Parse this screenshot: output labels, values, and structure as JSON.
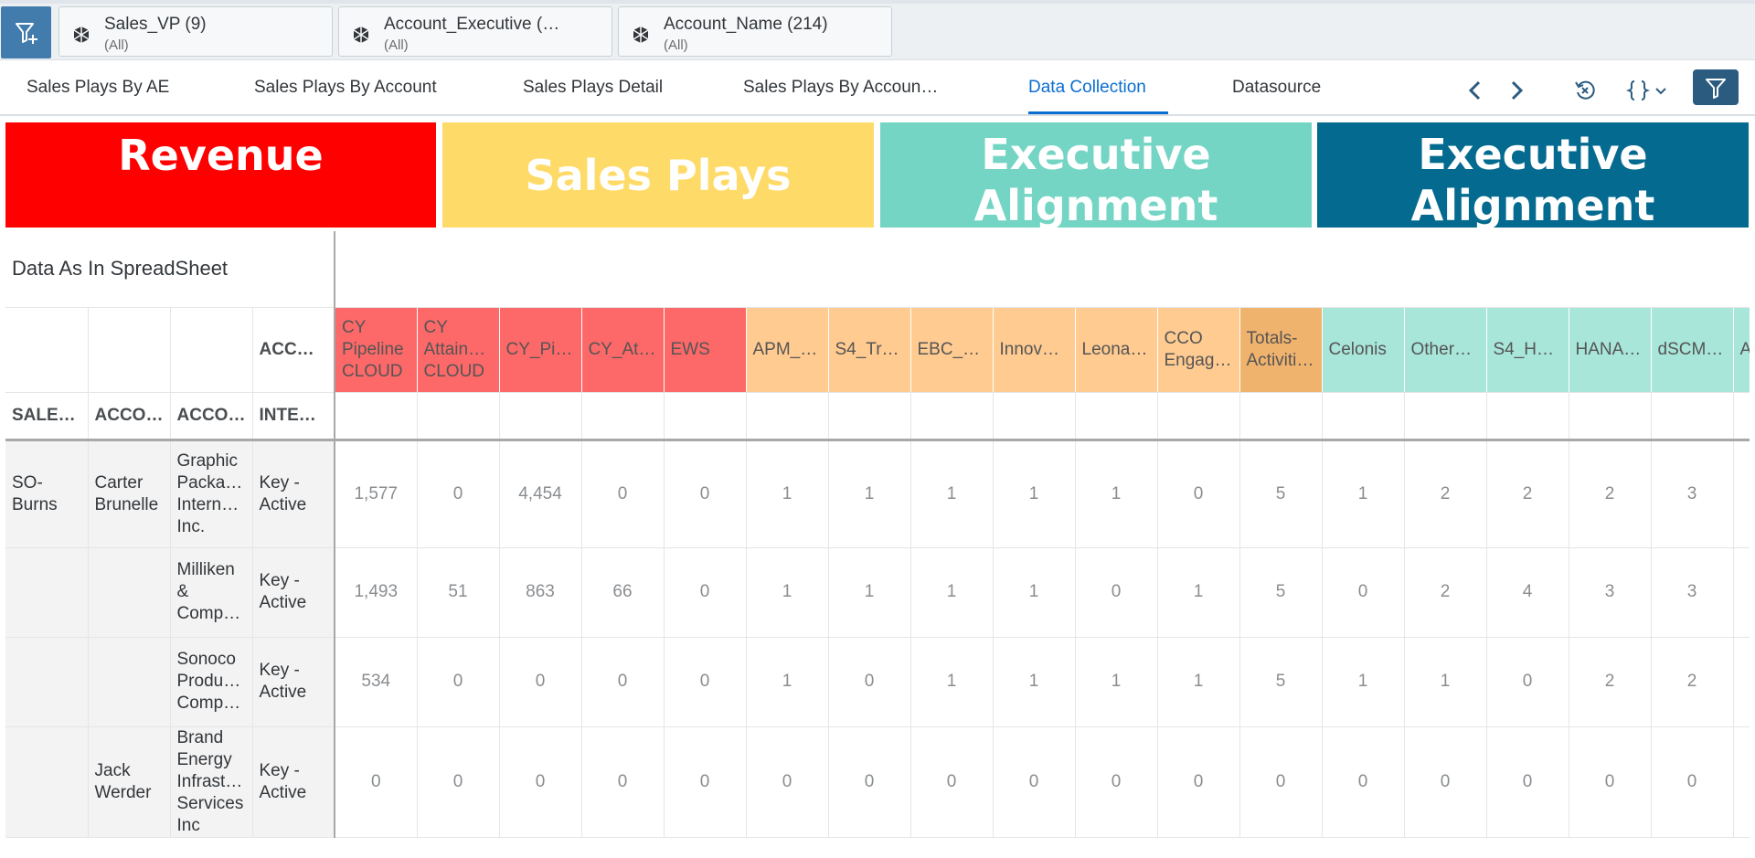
{
  "colors": {
    "revenue": "#ff0000",
    "sales_plays": "#fedb69",
    "exec_teal": "#74d5c4",
    "exec_blue": "#046a8f",
    "accent": "#0a6ed1",
    "col_red": "#fd6868",
    "col_orange": "#ffcb91",
    "col_orange_dark": "#f0b36d",
    "col_teal": "#a8e6d9"
  },
  "filters": [
    {
      "title": "Sales_VP (9)",
      "subtitle": "(All)",
      "icon": "cube-icon"
    },
    {
      "title": "Account_Executive (…",
      "subtitle": "(All)",
      "icon": "cube-icon"
    },
    {
      "title": "Account_Name (214)",
      "subtitle": "(All)",
      "icon": "cube-icon"
    }
  ],
  "tabs": [
    "Sales Plays By AE",
    "Sales Plays By Account",
    "Sales Plays Detail",
    "Sales Plays By Accoun…",
    "Data Collection",
    "Datasource"
  ],
  "toolbar_icons": [
    "chevron-left-icon",
    "chevron-right-icon",
    "reset-icon",
    "variables-icon",
    "filter-icon"
  ],
  "banners": [
    "Revenue",
    "Sales Plays",
    "Executive Alignment",
    "Executive Alignment"
  ],
  "table": {
    "title": "Data As In SpreadSheet",
    "dim_headers": [
      "SALE…",
      "ACCO…",
      "ACCO…",
      "INTER…"
    ],
    "dim_top_header": "ACCO…",
    "measures": [
      "CY Pipeline CLOUD",
      "CY Attain… CLOUD",
      "CY_Pi…",
      "CY_At…",
      "EWS",
      "APM_…",
      "S4_Tr…",
      "EBC_…",
      "Innov…",
      "Leona…",
      "CCO Engag…",
      "Totals-Activiti…",
      "Celonis",
      "Other…",
      "S4_H…",
      "HANA…",
      "dSCM…",
      "A"
    ],
    "rows": [
      {
        "sales": "SO-Burns",
        "ae": "Carter Brunelle",
        "account": "Graphic Packa… Intern… Inc.",
        "interaction": "Key - Active",
        "values": [
          "1,577",
          "0",
          "4,454",
          "0",
          "0",
          "1",
          "1",
          "1",
          "1",
          "1",
          "0",
          "5",
          "1",
          "2",
          "2",
          "2",
          "3",
          ""
        ]
      },
      {
        "sales": "",
        "ae": "",
        "account": "Milliken & Comp…",
        "interaction": "Key - Active",
        "values": [
          "1,493",
          "51",
          "863",
          "66",
          "0",
          "1",
          "1",
          "1",
          "1",
          "0",
          "1",
          "5",
          "0",
          "2",
          "4",
          "3",
          "3",
          ""
        ]
      },
      {
        "sales": "",
        "ae": "",
        "account": "Sonoco Produ… Comp…",
        "interaction": "Key - Active",
        "values": [
          "534",
          "0",
          "0",
          "0",
          "0",
          "1",
          "0",
          "1",
          "1",
          "1",
          "1",
          "5",
          "1",
          "1",
          "0",
          "2",
          "2",
          ""
        ]
      },
      {
        "sales": "",
        "ae": "Jack Werder",
        "account": "Brand Energy Infrast… Services Inc",
        "interaction": "Key - Active",
        "values": [
          "0",
          "0",
          "0",
          "0",
          "0",
          "0",
          "0",
          "0",
          "0",
          "0",
          "0",
          "0",
          "0",
          "0",
          "0",
          "0",
          "0",
          ""
        ]
      }
    ]
  }
}
